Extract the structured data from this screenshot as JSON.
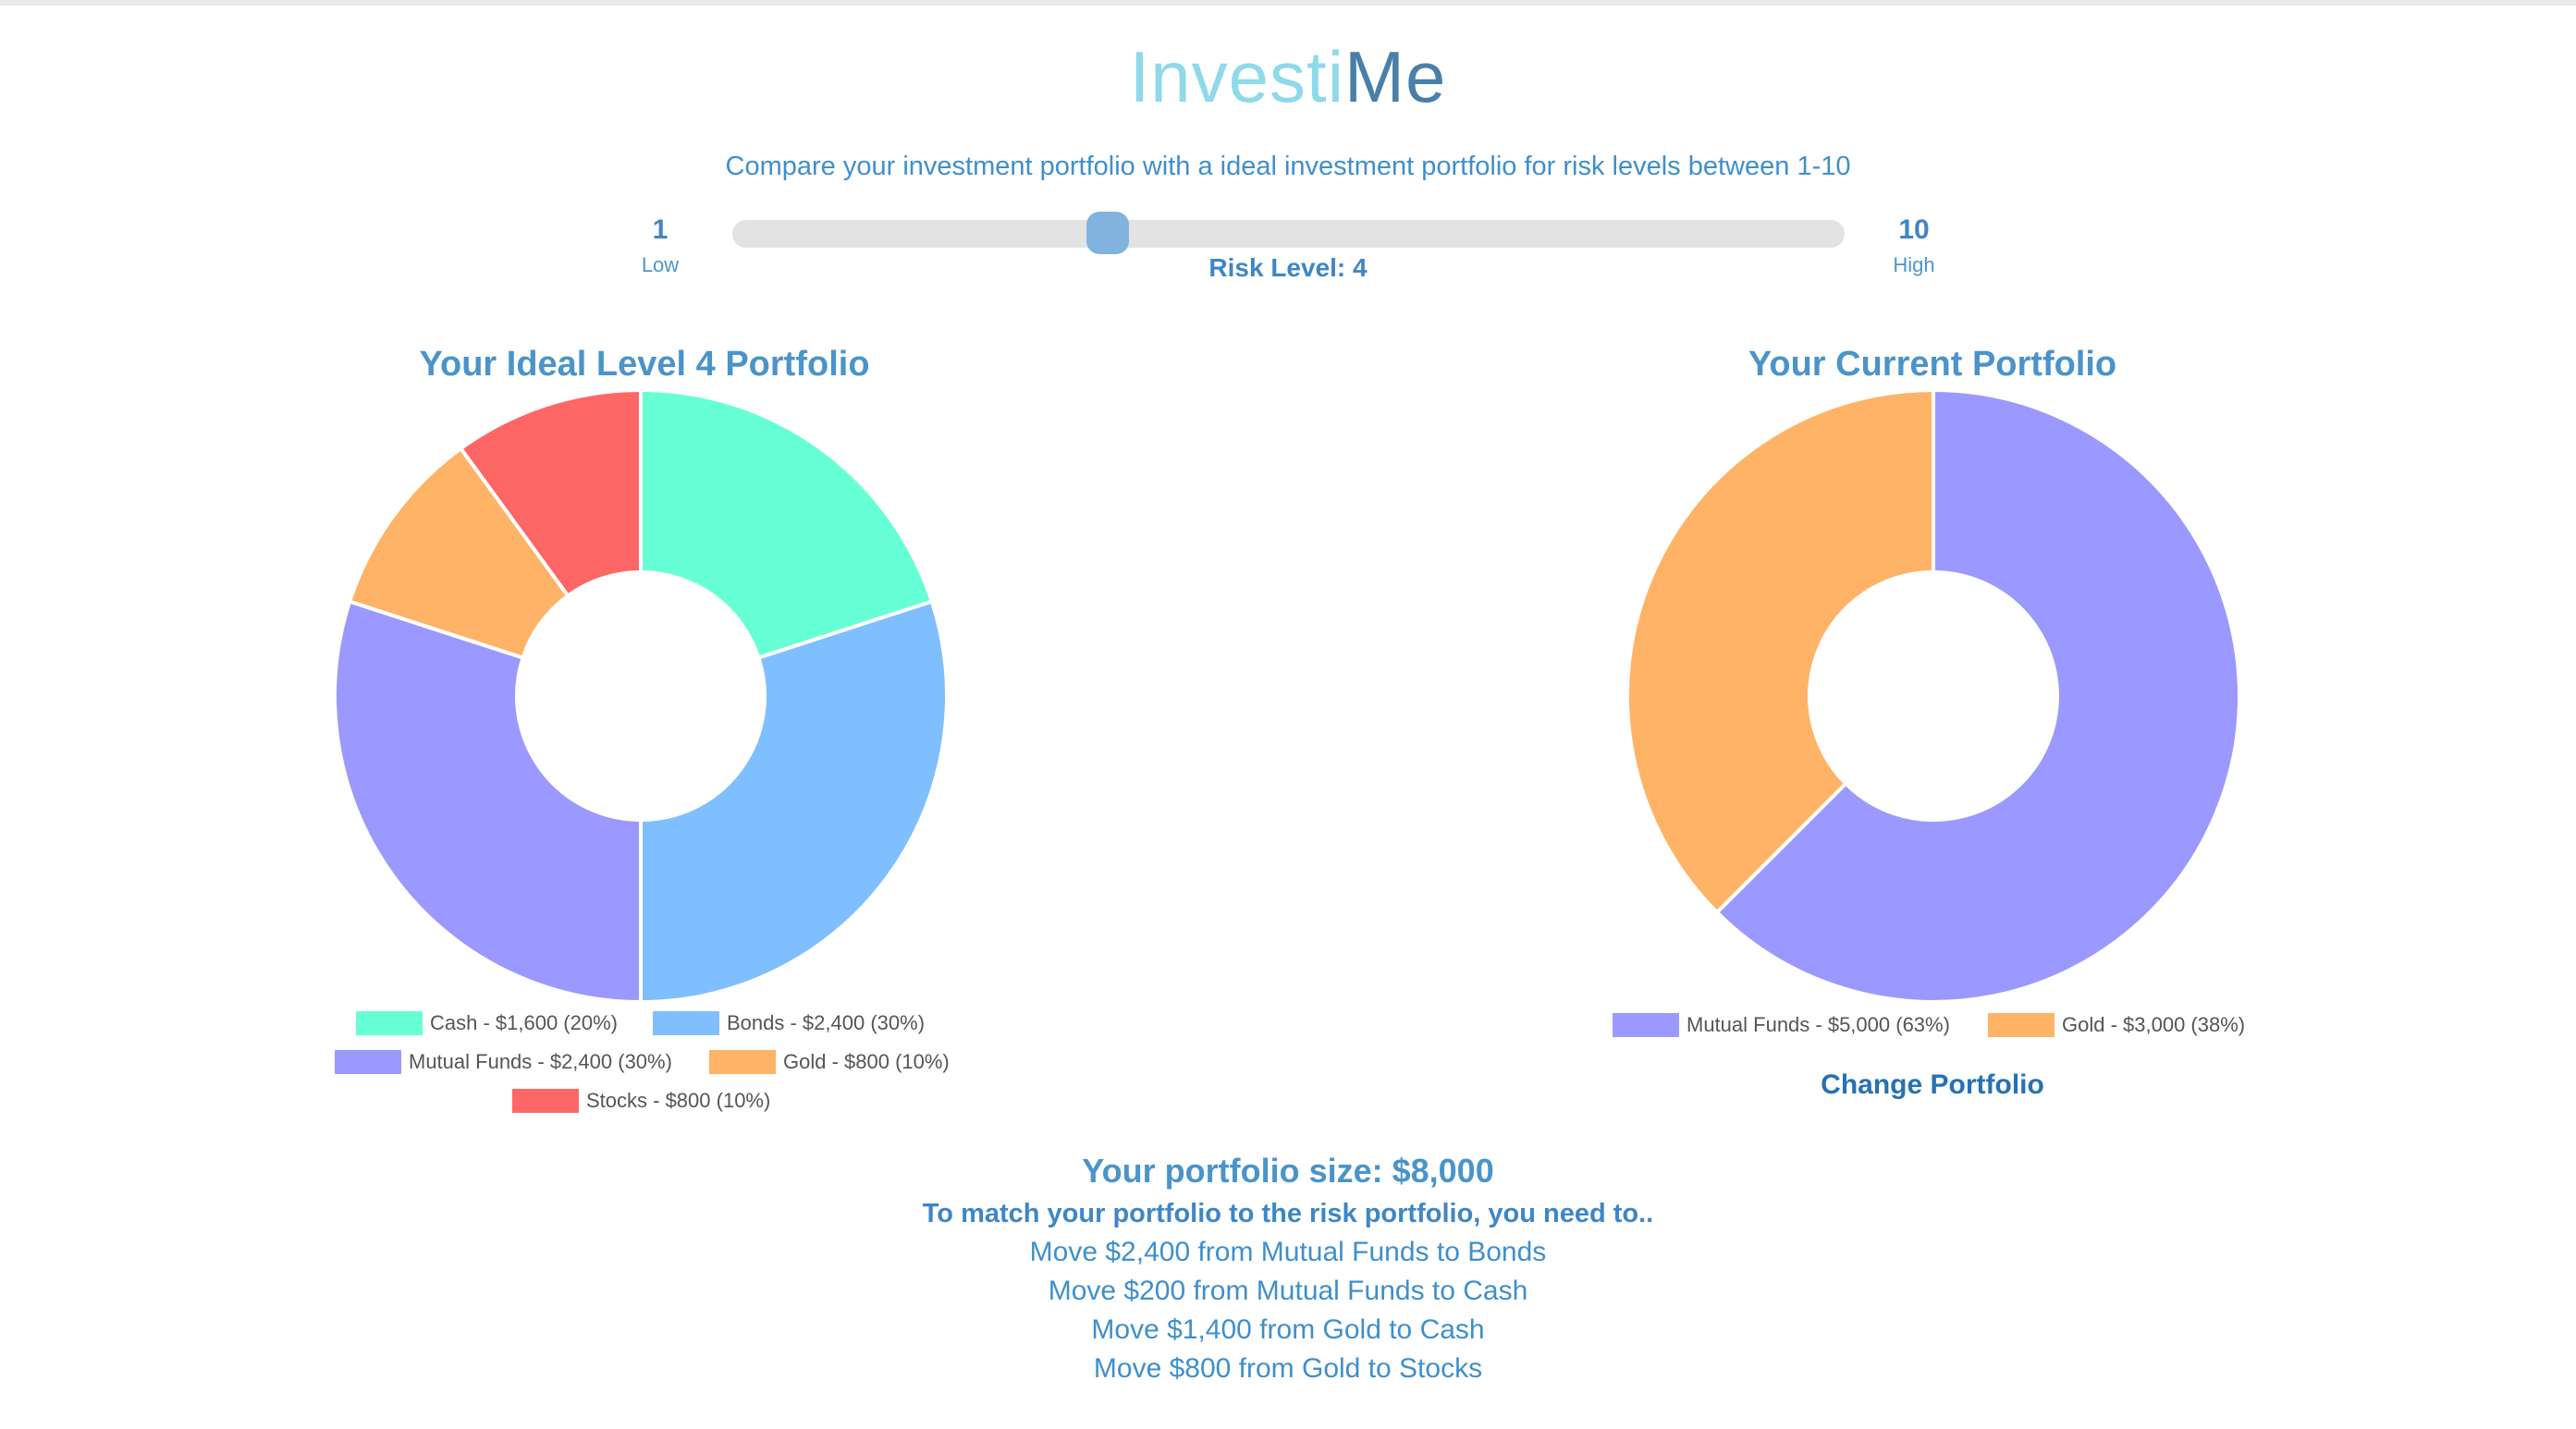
{
  "app": {
    "logo_part1": "Investi",
    "logo_part2": "Me",
    "subtitle": "Compare your investment portfolio with a ideal investment portfolio for risk levels between 1-10"
  },
  "risk_slider": {
    "min_value": "1",
    "min_label": "Low",
    "max_value": "10",
    "max_label": "High",
    "current_value": 4,
    "level_text": "Risk Level: 4"
  },
  "colors": {
    "cash": "#66ffd6",
    "bonds": "#80bfff",
    "mutual_funds": "#9b99ff",
    "gold": "#ffb366",
    "stocks": "#ff6666"
  },
  "ideal_portfolio": {
    "title": "Your Ideal Level 4 Portfolio",
    "legend": [
      "Cash - $1,600 (20%)",
      "Bonds - $2,400 (30%)",
      "Mutual Funds - $2,400 (30%)",
      "Gold - $800 (10%)",
      "Stocks - $800 (10%)"
    ]
  },
  "current_portfolio": {
    "title": "Your Current Portfolio",
    "legend": [
      "Mutual Funds - $5,000 (63%)",
      "Gold - $3,000 (38%)"
    ],
    "change_link": "Change Portfolio"
  },
  "chart_data": [
    {
      "type": "pie",
      "title": "Your Ideal Level 4 Portfolio",
      "categories": [
        "Cash",
        "Bonds",
        "Mutual Funds",
        "Gold",
        "Stocks"
      ],
      "values": [
        1600,
        2400,
        2400,
        800,
        800
      ],
      "percentages": [
        20,
        30,
        30,
        10,
        10
      ],
      "colors": [
        "#66ffd6",
        "#80bfff",
        "#9b99ff",
        "#ffb366",
        "#ff6666"
      ],
      "legend_position": "bottom"
    },
    {
      "type": "pie",
      "title": "Your Current Portfolio",
      "categories": [
        "Mutual Funds",
        "Gold"
      ],
      "values": [
        5000,
        3000
      ],
      "percentages": [
        63,
        38
      ],
      "colors": [
        "#9b99ff",
        "#ffb366"
      ],
      "legend_position": "bottom"
    }
  ],
  "summary": {
    "size_text": "Your portfolio size: $8,000",
    "instruction": "To match your portfolio to the risk portfolio, you need to..",
    "moves": [
      "Move $2,400 from Mutual Funds to Bonds",
      "Move $200 from Mutual Funds to Cash",
      "Move $1,400 from Gold to Cash",
      "Move $800 from Gold to Stocks"
    ]
  }
}
